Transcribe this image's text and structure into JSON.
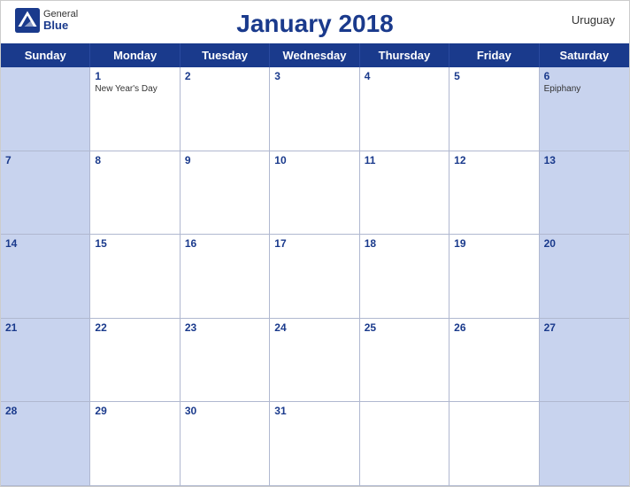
{
  "header": {
    "title": "January 2018",
    "country": "Uruguay",
    "logo": {
      "general": "General",
      "blue": "Blue"
    }
  },
  "days": [
    "Sunday",
    "Monday",
    "Tuesday",
    "Wednesday",
    "Thursday",
    "Friday",
    "Saturday"
  ],
  "weeks": [
    [
      {
        "num": "",
        "empty": true
      },
      {
        "num": "1",
        "event": "New Year's Day"
      },
      {
        "num": "2",
        "event": ""
      },
      {
        "num": "3",
        "event": ""
      },
      {
        "num": "4",
        "event": ""
      },
      {
        "num": "5",
        "event": ""
      },
      {
        "num": "6",
        "event": "Epiphany"
      }
    ],
    [
      {
        "num": "7",
        "event": ""
      },
      {
        "num": "8",
        "event": ""
      },
      {
        "num": "9",
        "event": ""
      },
      {
        "num": "10",
        "event": ""
      },
      {
        "num": "11",
        "event": ""
      },
      {
        "num": "12",
        "event": ""
      },
      {
        "num": "13",
        "event": ""
      }
    ],
    [
      {
        "num": "14",
        "event": ""
      },
      {
        "num": "15",
        "event": ""
      },
      {
        "num": "16",
        "event": ""
      },
      {
        "num": "17",
        "event": ""
      },
      {
        "num": "18",
        "event": ""
      },
      {
        "num": "19",
        "event": ""
      },
      {
        "num": "20",
        "event": ""
      }
    ],
    [
      {
        "num": "21",
        "event": ""
      },
      {
        "num": "22",
        "event": ""
      },
      {
        "num": "23",
        "event": ""
      },
      {
        "num": "24",
        "event": ""
      },
      {
        "num": "25",
        "event": ""
      },
      {
        "num": "26",
        "event": ""
      },
      {
        "num": "27",
        "event": ""
      }
    ],
    [
      {
        "num": "28",
        "event": ""
      },
      {
        "num": "29",
        "event": ""
      },
      {
        "num": "30",
        "event": ""
      },
      {
        "num": "31",
        "event": ""
      },
      {
        "num": "",
        "empty": true
      },
      {
        "num": "",
        "empty": true
      },
      {
        "num": "",
        "empty": true
      }
    ]
  ],
  "colors": {
    "header_bg": "#1a3a8c",
    "cell_stripe": "#c8d3ee",
    "accent": "#1a3a8c"
  }
}
